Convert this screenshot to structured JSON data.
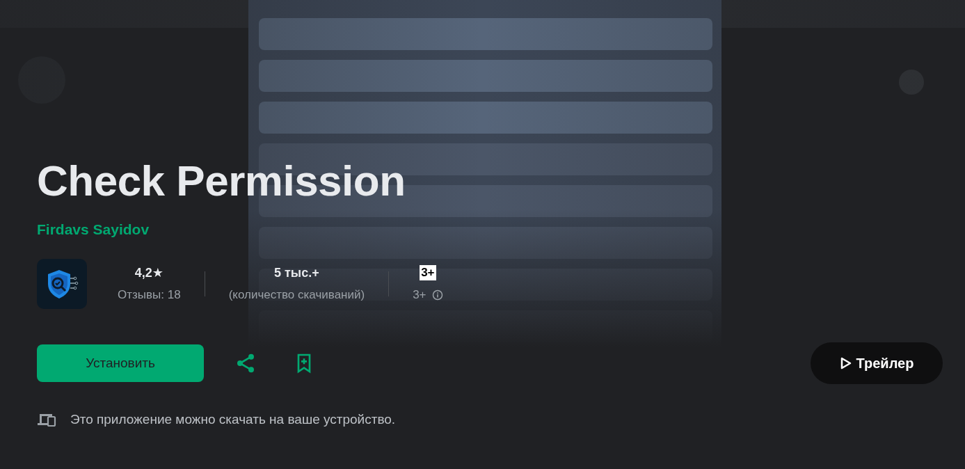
{
  "app": {
    "title": "Check Permission",
    "developer": "Firdavs Sayidov"
  },
  "stats": [
    {
      "kind": "rating",
      "value": "4,2★",
      "label": "Отзывы: 18"
    },
    {
      "kind": "downloads",
      "value": "5 тыс.+",
      "label": "(количество скачиваний)"
    },
    {
      "kind": "age",
      "value": "3+",
      "label": "3+"
    }
  ],
  "actions": {
    "install": "Установить",
    "trailer": "Трейлер"
  },
  "note": "Это приложение можно скачать на ваше устройство."
}
